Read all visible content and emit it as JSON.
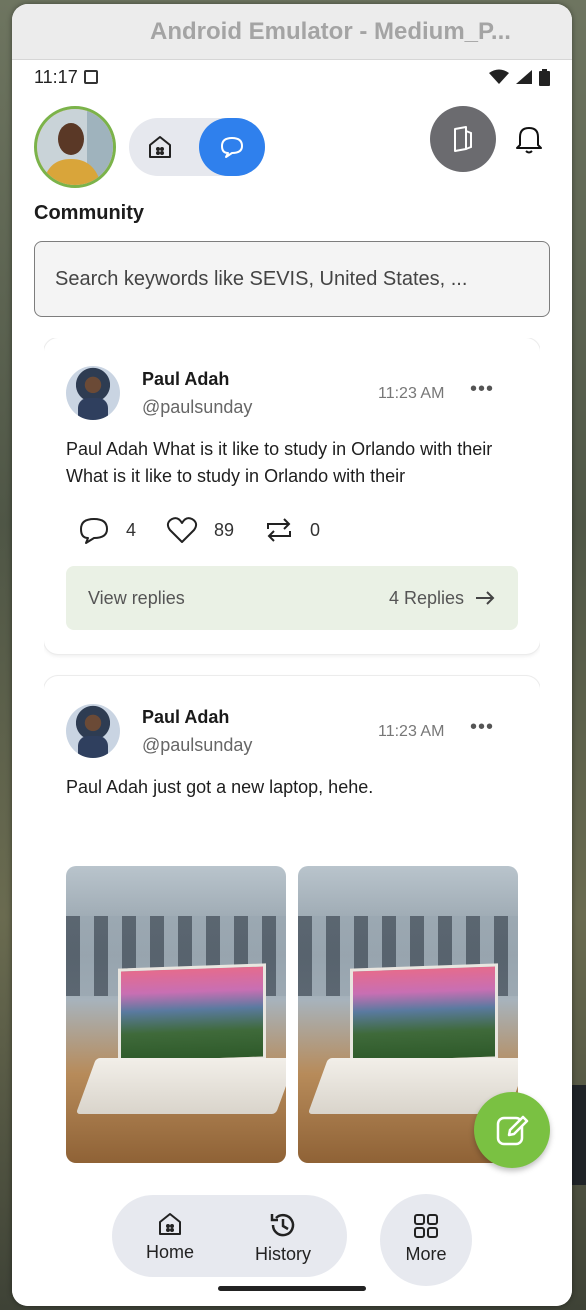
{
  "window": {
    "title": "Android Emulator - Medium_P..."
  },
  "status_bar": {
    "time": "11:17"
  },
  "header": {
    "avatar": "user-avatar",
    "icons": {
      "home": "home-icon",
      "chat": "chat-icon",
      "docs": "documents-icon",
      "bell": "bell-icon"
    },
    "active_toggle": "chat"
  },
  "community": {
    "title": "Community",
    "search_placeholder": "Search keywords like SEVIS, United States, ..."
  },
  "posts": [
    {
      "name": "Paul Adah",
      "handle": "@paulsunday",
      "time": "11:23 AM",
      "more": "•••",
      "text": "Paul Adah What is it like to study in Orlando with their What is it like to study in Orlando with their",
      "comments": "4",
      "likes": "89",
      "reposts": "0",
      "view_replies": "View replies",
      "replies_count": "4 Replies"
    },
    {
      "name": "Paul Adah",
      "handle": "@paulsunday",
      "time": "11:23 AM",
      "more": "•••",
      "text": "Paul Adah just got a new laptop, hehe.",
      "images": [
        "laptop-photo",
        "laptop-photo"
      ]
    }
  ],
  "bottom_nav": {
    "home": "Home",
    "history": "History",
    "more": "More"
  },
  "colors": {
    "accent_blue": "#2f80ed",
    "accent_green": "#7ac142",
    "replies_bg": "#eaf1e5"
  }
}
